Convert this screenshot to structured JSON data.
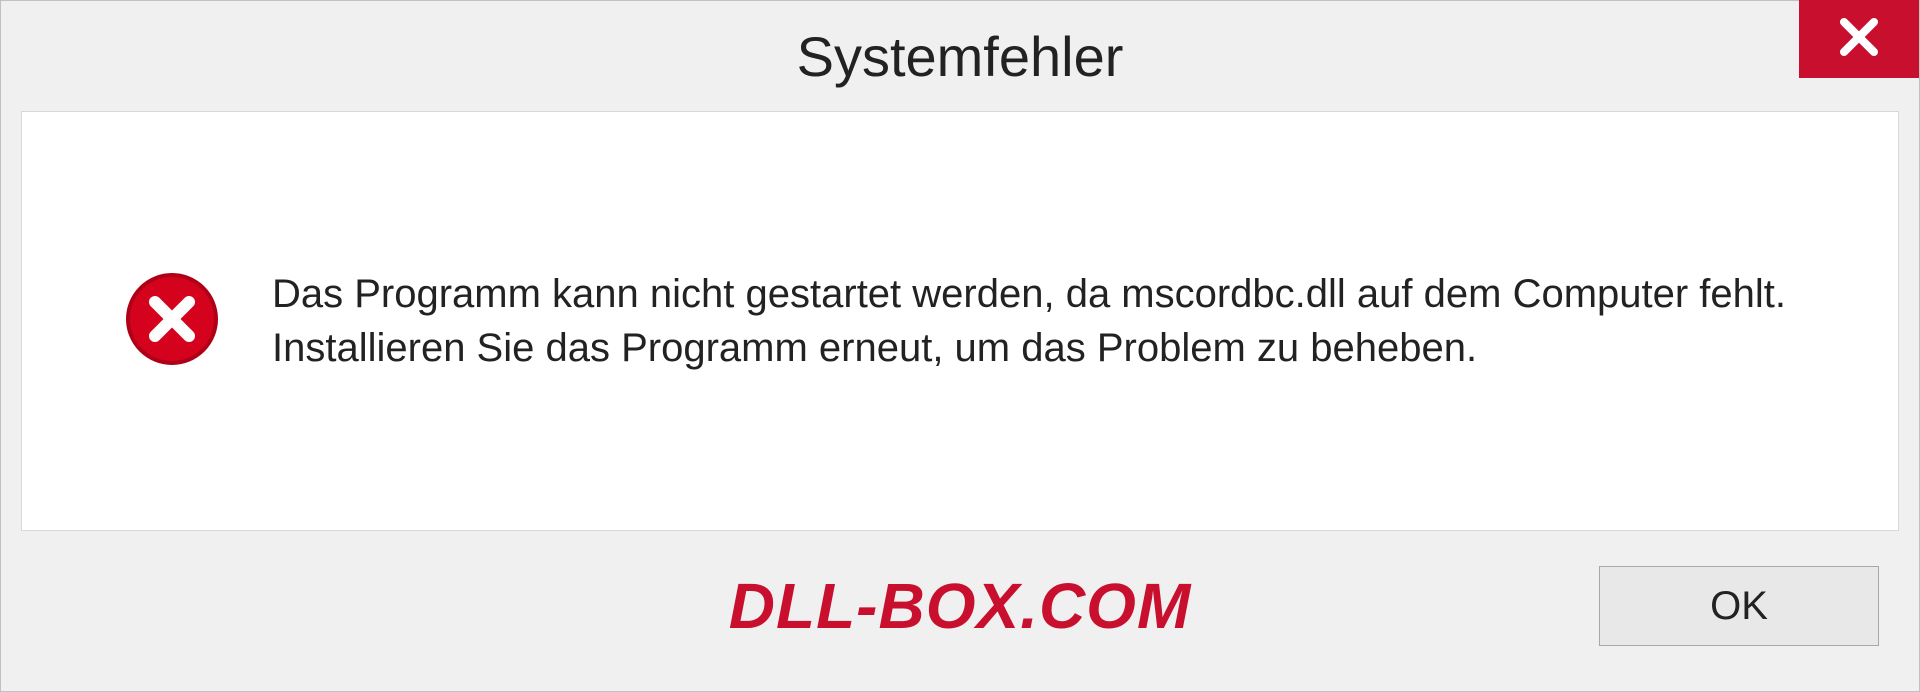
{
  "dialog": {
    "title": "Systemfehler",
    "message": "Das Programm kann nicht gestartet werden, da mscordbc.dll auf dem Computer fehlt. Installieren Sie das Programm erneut, um das Problem zu beheben.",
    "ok_label": "OK"
  },
  "watermark": "DLL-BOX.COM"
}
